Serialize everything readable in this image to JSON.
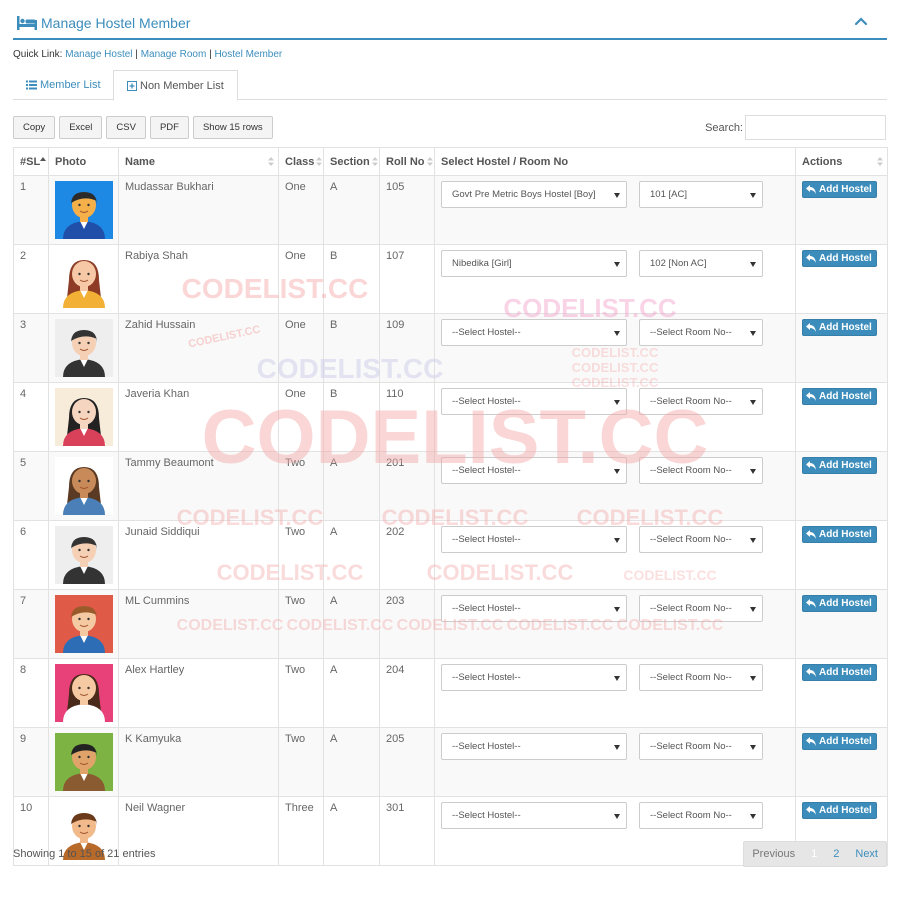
{
  "panel": {
    "title": "Manage Hostel Member"
  },
  "quicklinks": {
    "label": "Quick Link:",
    "separator": "|",
    "items": [
      "Manage Hostel",
      "Manage Room",
      "Hostel Member"
    ]
  },
  "tabs": [
    "Member List",
    "Non Member List"
  ],
  "toolbar": {
    "buttons": [
      "Copy",
      "Excel",
      "CSV",
      "PDF",
      "Show 15 rows"
    ],
    "search_label": "Search:",
    "search_value": ""
  },
  "table": {
    "headers": [
      "#SL",
      "Photo",
      "Name",
      "Class",
      "Section",
      "Roll No",
      "Select Hostel / Room No",
      "Actions"
    ],
    "action_label": "Add Hostel",
    "rows": [
      {
        "sl": "1",
        "name": "Mudassar Bukhari",
        "class": "One",
        "section": "A",
        "roll": "105",
        "hostel": "Govt Pre Metric Boys Hostel [Boy]",
        "room": "101 [AC]"
      },
      {
        "sl": "2",
        "name": "Rabiya Shah",
        "class": "One",
        "section": "B",
        "roll": "107",
        "hostel": "Nibedika [Girl]",
        "room": "102 [Non AC]"
      },
      {
        "sl": "3",
        "name": "Zahid Hussain",
        "class": "One",
        "section": "B",
        "roll": "109",
        "hostel": "--Select Hostel--",
        "room": "--Select Room No--"
      },
      {
        "sl": "4",
        "name": "Javeria Khan",
        "class": "One",
        "section": "B",
        "roll": "110",
        "hostel": "--Select Hostel--",
        "room": "--Select Room No--"
      },
      {
        "sl": "5",
        "name": "Tammy Beaumont",
        "class": "Two",
        "section": "A",
        "roll": "201",
        "hostel": "--Select Hostel--",
        "room": "--Select Room No--"
      },
      {
        "sl": "6",
        "name": "Junaid Siddiqui",
        "class": "Two",
        "section": "A",
        "roll": "202",
        "hostel": "--Select Hostel--",
        "room": "--Select Room No--"
      },
      {
        "sl": "7",
        "name": "ML Cummins",
        "class": "Two",
        "section": "A",
        "roll": "203",
        "hostel": "--Select Hostel--",
        "room": "--Select Room No--"
      },
      {
        "sl": "8",
        "name": "Alex Hartley",
        "class": "Two",
        "section": "A",
        "roll": "204",
        "hostel": "--Select Hostel--",
        "room": "--Select Room No--"
      },
      {
        "sl": "9",
        "name": "K Kamyuka",
        "class": "Two",
        "section": "A",
        "roll": "205",
        "hostel": "--Select Hostel--",
        "room": "--Select Room No--"
      },
      {
        "sl": "10",
        "name": "Neil Wagner",
        "class": "Three",
        "section": "A",
        "roll": "301",
        "hostel": "--Select Hostel--",
        "room": "--Select Room No--"
      }
    ]
  },
  "footer": {
    "info": "Showing 1 to 15 of 21 entries",
    "pagination": [
      "Previous",
      "1",
      "2",
      "Next"
    ]
  },
  "watermark": "CODELIST.CC",
  "colors": {
    "accent": "#3c8dbc",
    "watermark": "#f4a6a6"
  }
}
